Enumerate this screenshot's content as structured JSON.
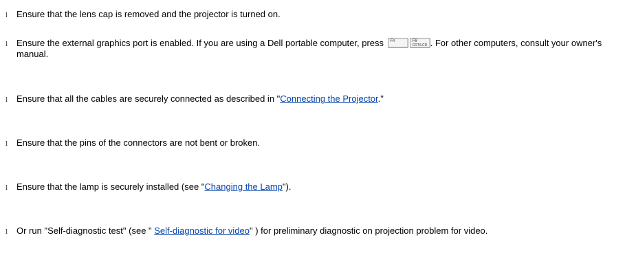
{
  "bullet_glyph": "l",
  "items": [
    {
      "before": "Ensure that the lens cap is removed and the projector is turned on."
    },
    {
      "before": "Ensure the external graphics port is enabled. If you are using a Dell portable computer, press ",
      "keys": [
        {
          "icon": "fn-key-icon",
          "label": "Fn"
        },
        {
          "icon": "f8-crt-lcd-key-icon",
          "label": "F8",
          "sub": "CRT/LCD"
        }
      ],
      "after": ". For other computers, consult your owner's manual."
    },
    {
      "before": "Ensure that all the cables are securely connected as described in \"",
      "link": "Connecting the Projector",
      "after": ".\""
    },
    {
      "before": "Ensure that the pins of the connectors are not bent or broken."
    },
    {
      "before": "Ensure that the lamp is securely installed (see \"",
      "link": "Changing the Lamp",
      "after": "\")."
    },
    {
      "before": "Or run \"Self-diagnostic test\" (see \" ",
      "link": "Self-diagnostic for video",
      "after": "\" ) for preliminary diagnostic on projection problem for video."
    }
  ]
}
